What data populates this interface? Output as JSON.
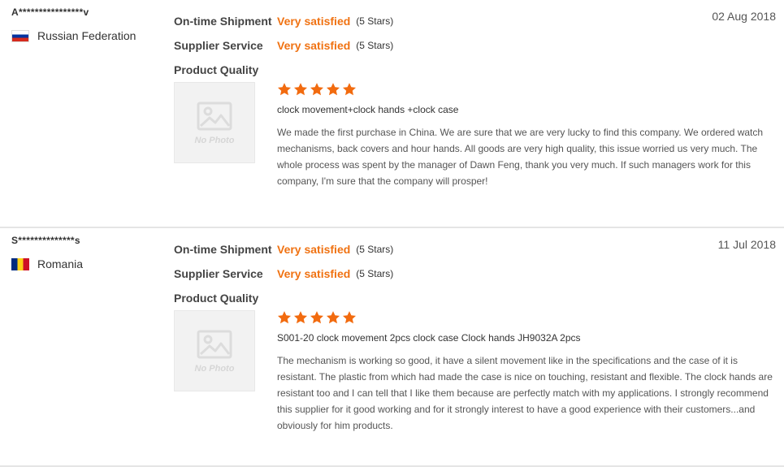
{
  "labels": {
    "ontime": "On-time Shipment",
    "supplier": "Supplier Service",
    "quality": "Product Quality",
    "no_photo": "No Photo"
  },
  "colors": {
    "accent": "#f07212",
    "star": "#f26b0f"
  },
  "reviews": [
    {
      "buyer": "A****************v",
      "country": "Russian Federation",
      "flag": "russia-flag",
      "date": "02 Aug 2018",
      "ontime": {
        "value": "Very satisfied",
        "stars": "(5 Stars)"
      },
      "supplier": {
        "value": "Very satisfied",
        "stars": "(5 Stars)"
      },
      "quality_stars": 5,
      "product": "clock movement+clock hands +clock case",
      "text": "We made the first purchase in China. We are sure that we are very lucky to find this company. We ordered watch mechanisms, back covers and hour hands. All goods are very high quality, this issue worried us very much. The whole process was spent by the manager of Dawn Feng, thank you very much. If such managers work for this company, I'm sure that the company will prosper!"
    },
    {
      "buyer": "S**************s",
      "country": "Romania",
      "flag": "romania-flag",
      "date": "11 Jul 2018",
      "ontime": {
        "value": "Very satisfied",
        "stars": "(5 Stars)"
      },
      "supplier": {
        "value": "Very satisfied",
        "stars": "(5 Stars)"
      },
      "quality_stars": 5,
      "product": "S001-20 clock movement 2pcs clock case Clock hands JH9032A 2pcs",
      "text": "The mechanism is working so good, it have a silent movement like in the specifications and the case of it is resistant. The plastic from which had made the case is nice on touching, resistant and flexible. The clock hands are resistant too and I can tell that I like them because are perfectly match with my applications. I strongly recommend this supplier for it good working and for it strongly interest to have a good experience with their customers...and obviously for him products."
    }
  ]
}
